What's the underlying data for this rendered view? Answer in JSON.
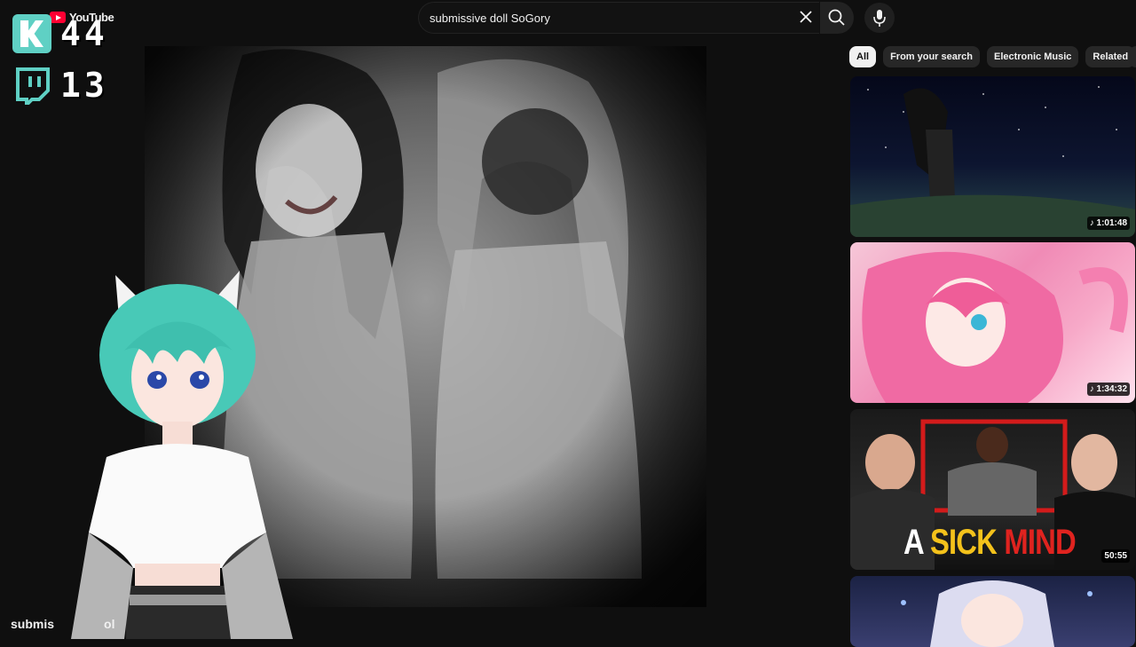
{
  "youtube": {
    "logo_text": "YouTube"
  },
  "search": {
    "query": "submissive doll SoGory"
  },
  "counters": {
    "kick": "44",
    "twitch": "13"
  },
  "chips": [
    "All",
    "From your search",
    "Electronic Music",
    "Related"
  ],
  "recommendations": [
    {
      "duration": "1:01:48"
    },
    {
      "duration": "1:34:32"
    },
    {
      "duration": "50:55",
      "title_overlay": [
        "A",
        "SICK",
        "MIND"
      ]
    },
    {
      "duration": ""
    }
  ],
  "video_title_partial": "submis",
  "video_title_partial_end": "ol",
  "colors": {
    "background": "#0f0f0f",
    "kick": "#5fd0c4",
    "twitch": "#5fd0c4",
    "youtube_red": "#ff0033"
  },
  "icons": [
    "kick-logo-icon",
    "twitch-logo-icon",
    "youtube-logo-icon",
    "close-icon",
    "search-icon",
    "mic-icon",
    "music-note-icon"
  ]
}
